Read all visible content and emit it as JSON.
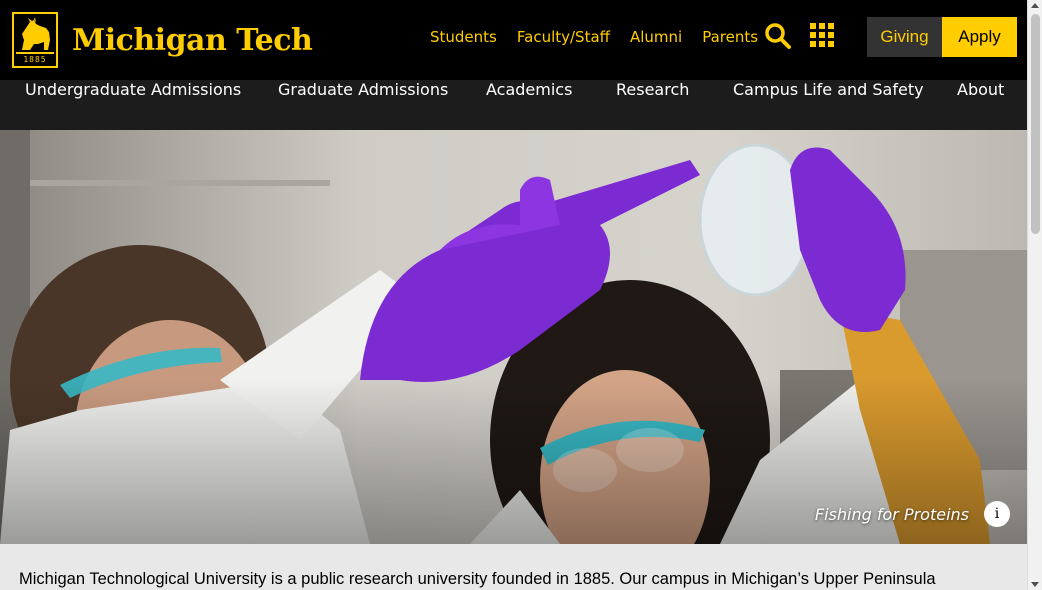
{
  "brand": {
    "name": "Michigan Tech",
    "seal_year": "1885",
    "accent": "#ffcd00"
  },
  "utility_nav": [
    "Students",
    "Faculty/Staff",
    "Alumni",
    "Parents"
  ],
  "icons": {
    "search": "search-icon",
    "menu": "grid-menu-icon",
    "info": "info-icon"
  },
  "cta": {
    "giving": "Giving",
    "apply": "Apply"
  },
  "main_nav": [
    "Undergraduate Admissions",
    "Graduate Admissions",
    "Academics",
    "Research",
    "Campus Life and Safety",
    "About"
  ],
  "hero": {
    "caption": "Fishing for Proteins",
    "info_label": "i"
  },
  "intro": {
    "text": "Michigan Technological University is a public research university founded in 1885. Our campus in Michigan’s Upper Peninsula"
  }
}
